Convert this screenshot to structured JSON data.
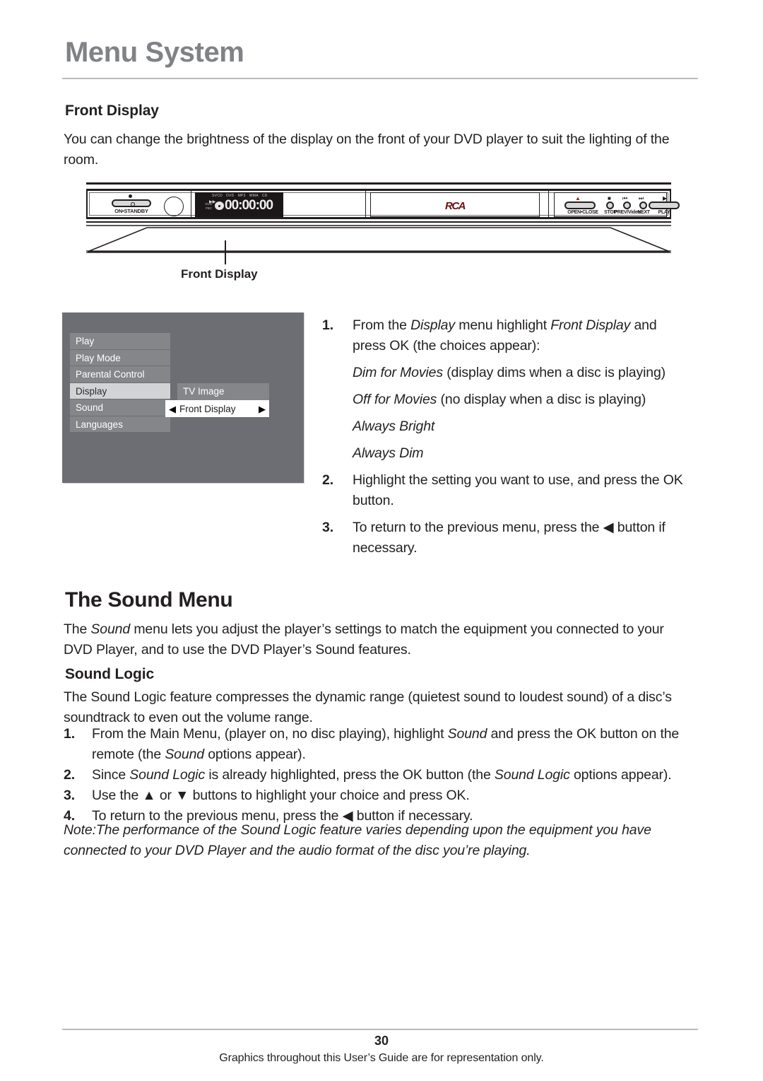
{
  "header": {
    "chapter_title": "Menu System"
  },
  "front_display": {
    "heading": "Front Display",
    "intro": "You can change the brightness of the display on the front of your DVD player to suit the lighting of the room.",
    "callout_label": "Front Display"
  },
  "player_graphic": {
    "standby_label": "ON•STANDBY",
    "display_time": "00:00:00",
    "display_indicators": [
      "SVCD",
      "DVD",
      "MP3",
      "WMA",
      "CD"
    ],
    "display_left_lines": [
      "DVD",
      "PBC"
    ],
    "brand_logo": "RCA",
    "buttons": [
      {
        "label": "OPEN•CLOSE",
        "icon": "eject-icon",
        "symbol": "▲"
      },
      {
        "label": "STOP",
        "icon": "stop-icon",
        "symbol": "■"
      },
      {
        "label": "PREV/Video",
        "icon": "previous-icon",
        "symbol": "⏮"
      },
      {
        "label": "NEXT",
        "icon": "next-icon",
        "symbol": "⏭"
      },
      {
        "label": "PLAY",
        "icon": "play-icon",
        "symbol": "▶"
      }
    ]
  },
  "osd": {
    "menu_items": [
      {
        "label": "Play",
        "selected": false
      },
      {
        "label": "Play Mode",
        "selected": false
      },
      {
        "label": "Parental Control",
        "selected": false
      },
      {
        "label": "Display",
        "selected": true
      },
      {
        "label": "Sound",
        "selected": false
      },
      {
        "label": "Languages",
        "selected": false
      }
    ],
    "submenu_items": [
      {
        "label": "TV Image"
      }
    ],
    "active_item": {
      "label": "Front Display",
      "left_arrow": "◀",
      "right_arrow": "▶"
    }
  },
  "front_display_steps": {
    "step1": {
      "num": "1.",
      "part1": "From the ",
      "italic1": "Display",
      "part2": " menu highlight ",
      "italic2": "Front Display",
      "part3": " and press OK (the choices appear):"
    },
    "choices": [
      {
        "italic": "Dim for Movies",
        "plain": " (display dims when a disc is playing)"
      },
      {
        "italic": "Off for Movies",
        "plain": " (no display when a disc is playing)"
      },
      {
        "italic": "Always Bright",
        "plain": ""
      },
      {
        "italic": "Always Dim",
        "plain": ""
      }
    ],
    "step2": {
      "num": "2.",
      "text": "Highlight the setting you want to use, and press the OK button."
    },
    "step3": {
      "num": "3.",
      "part1": "To return to the previous menu, press the ",
      "arrow": "◀",
      "part2": " button if necessary."
    }
  },
  "sound_menu": {
    "heading": "The Sound Menu",
    "intro_part1": "The ",
    "intro_italic": "Sound",
    "intro_part2": " menu lets you adjust the player’s settings to match the equipment you connected to your DVD Player, and to use the DVD Player’s Sound features.",
    "sound_logic_heading": "Sound Logic",
    "sound_logic_intro": "The Sound Logic feature compresses the dynamic range (quietest sound to loudest sound) of a disc’s soundtrack to even out the volume range.",
    "steps": [
      {
        "num": "1.",
        "part1": "From the Main Menu, (player on, no disc playing), highlight ",
        "italic1": "Sound",
        "part2": " and press the OK button on the remote (the ",
        "italic2": "Sound",
        "part3": " options appear)."
      },
      {
        "num": "2.",
        "part1": "Since ",
        "italic1": "Sound Logic",
        "part2": " is already highlighted, press the OK button (the ",
        "italic2": "Sound Logic",
        "part3": " options appear)."
      },
      {
        "num": "3.",
        "part1": "Use the ",
        "arrow_up": "▲",
        "part2": " or ",
        "arrow_down": "▼",
        "part3": " buttons to highlight your choice and press OK."
      },
      {
        "num": "4.",
        "part1": "To return to the previous menu, press the ",
        "arrow": "◀",
        "part2": " button if necessary."
      }
    ],
    "note": "Note:The performance of the Sound Logic feature varies depending upon the equipment you have connected to your DVD Player and the audio format of the disc you’re playing."
  },
  "footer": {
    "page_number": "30",
    "disclaimer": "Graphics throughout this User’s Guide are for representation only."
  }
}
